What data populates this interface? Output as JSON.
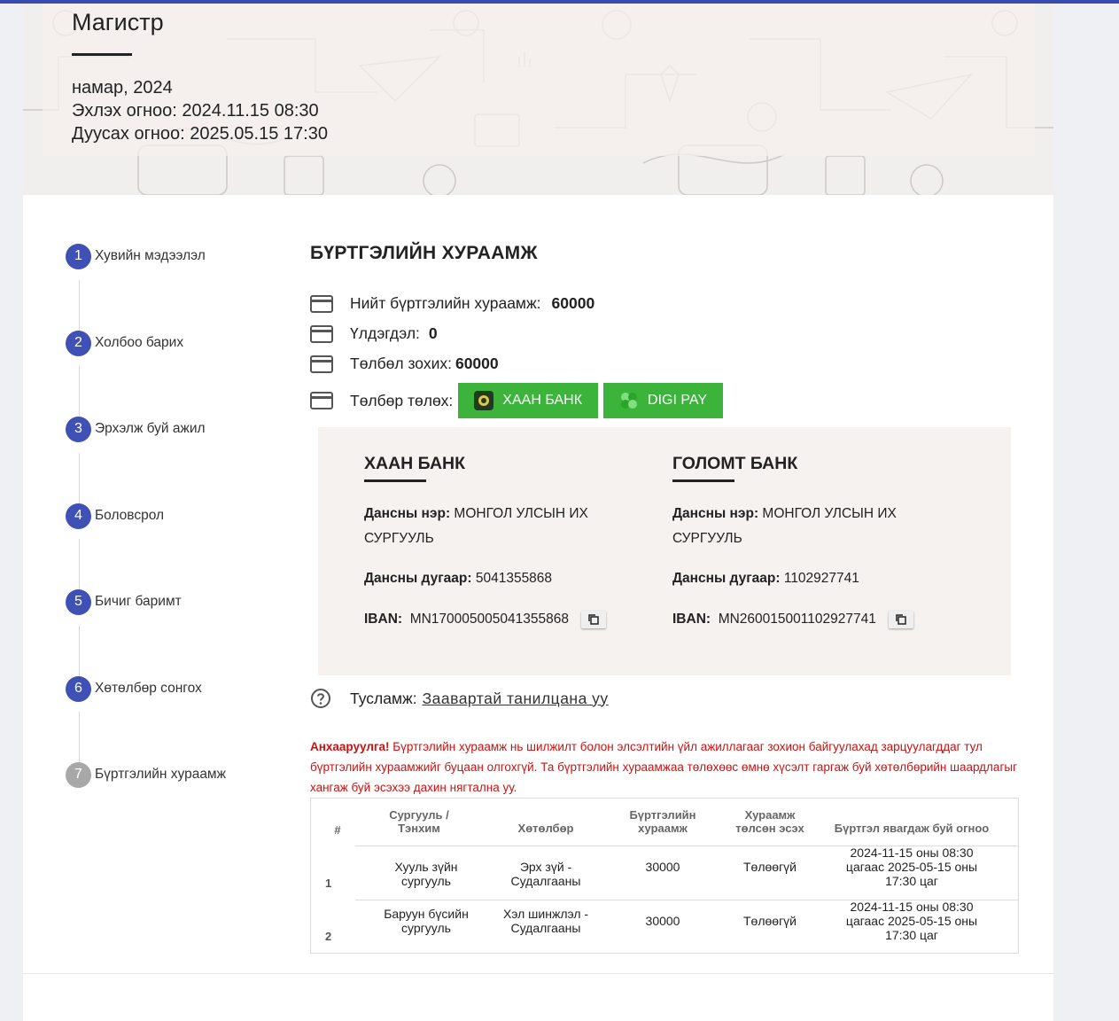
{
  "header": {
    "degree": "Магистр",
    "term": "намар, 2024",
    "start": "Эхлэх огноо: 2024.11.15 08:30",
    "end": "Дуусах огноо: 2025.05.15 17:30"
  },
  "stepper": {
    "steps": [
      {
        "num": "1",
        "label": "Хувийн мэдээлэл",
        "state": "done"
      },
      {
        "num": "2",
        "label": "Холбоо барих",
        "state": "done"
      },
      {
        "num": "3",
        "label": "Эрхэлж буй ажил",
        "state": "done"
      },
      {
        "num": "4",
        "label": "Боловсрол",
        "state": "done"
      },
      {
        "num": "5",
        "label": "Бичиг баримт",
        "state": "done"
      },
      {
        "num": "6",
        "label": "Хөтөлбөр сонгох",
        "state": "done"
      },
      {
        "num": "7",
        "label": "Бүртгэлийн хураамж",
        "state": "current"
      }
    ]
  },
  "fee": {
    "title": "БҮРТГЭЛИЙН ХУРААМЖ",
    "total_label": "Нийт бүртгэлийн хураамж:",
    "total_value": "60000",
    "balance_label": "Үлдэгдэл:",
    "balance_value": "0",
    "due_label": "Төлбөл зохих:",
    "due_value": "60000",
    "pay_label": "Төлбөр төлөх:",
    "khan_button": "ХААН БАНК",
    "digi_button": "DIGI PAY"
  },
  "banks": [
    {
      "name": "ХААН БАНК",
      "account_name_label": "Дансны нэр:",
      "account_name": "МОНГОЛ УЛСЫН ИХ СУРГУУЛЬ",
      "account_no_label": "Дансны дугаар:",
      "account_no": "5041355868",
      "iban_label": "IBAN:",
      "iban": "MN170005005041355868"
    },
    {
      "name": "ГОЛОМТ БАНК",
      "account_name_label": "Дансны нэр:",
      "account_name": "МОНГОЛ УЛСЫН ИХ СУРГУУЛЬ",
      "account_no_label": "Дансны дугаар:",
      "account_no": "1102927741",
      "iban_label": "IBAN:",
      "iban": "MN260015001102927741"
    }
  ],
  "help": {
    "label": "Тусламж:",
    "link": "Заавартай танилцана уу"
  },
  "warning": {
    "prefix": "Анхааруулга!",
    "text": " Бүртгэлийн хураамж нь шилжилт болон элсэлтийн үйл ажиллагааг зохион байгуулахад зарцуулагддаг тул бүртгэлийн хураамжийг буцаан олгохгүй. Та бүртгэлийн хураамжаа төлөхөөс өмнө хүсэлт гаргаж буй хөтөлбөрийн шаардлагыг хангаж буй эсэхээ дахин нягтална уу."
  },
  "table": {
    "headers": {
      "num": "#",
      "school": "Сургууль / Тэнхим",
      "program": "Хөтөлбөр",
      "fee": "Бүртгэлийн хураамж",
      "paid": "Хураамж төлсөн эсэх",
      "period": "Бүртгэл явагдаж буй огноо"
    },
    "rows": [
      {
        "num": "1",
        "school": "Хууль зүйн сургууль",
        "program": "Эрх зүй - Судалгааны",
        "fee": "30000",
        "paid": "Төлөөгүй",
        "period": "2024-11-15 оны 08:30 цагаас 2025-05-15 оны 17:30 цаг"
      },
      {
        "num": "2",
        "school": "Баруун бүсийн сургууль",
        "program": "Хэл шинжлэл - Судалгааны",
        "fee": "30000",
        "paid": "Төлөөгүй",
        "period": "2024-11-15 оны 08:30 цагаас 2025-05-15 оны 17:30 цаг"
      }
    ]
  },
  "colors": {
    "accent": "#3f51b5",
    "step_inactive": "#a8a8a8",
    "pay_button": "#3cb43c",
    "warning": "#cc1111"
  }
}
